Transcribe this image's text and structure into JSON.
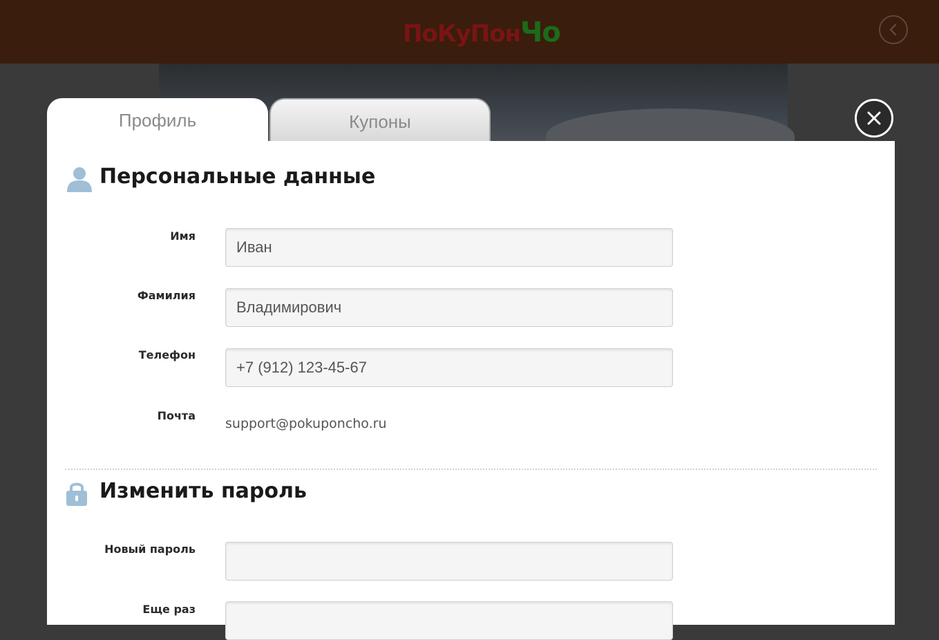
{
  "header": {
    "logo_main": "ПоКуПон",
    "logo_accent": "Чо",
    "back_icon": "chevron-left-icon"
  },
  "tabs": [
    {
      "label": "Профиль",
      "active": true
    },
    {
      "label": "Купоны",
      "active": false
    }
  ],
  "close_icon": "close-icon",
  "personal": {
    "title": "Персональные данные",
    "icon": "user-icon",
    "fields": {
      "first_name": {
        "label": "Имя",
        "value": "Иван"
      },
      "last_name": {
        "label": "Фамилия",
        "value": "Владимирович"
      },
      "phone": {
        "label": "Телефон",
        "value": "+7 (912) 123-45-67"
      },
      "email": {
        "label": "Почта",
        "value": "support@pokuponcho.ru"
      }
    }
  },
  "password": {
    "title": "Изменить пароль",
    "icon": "lock-icon",
    "new_label": "Новый пароль",
    "repeat_label": "Еще раз"
  },
  "colors": {
    "header_bg": "#3a1d0c",
    "logo_red": "#7a1414",
    "logo_green": "#1c6b1a",
    "icon_blue": "#9fbfd6"
  }
}
